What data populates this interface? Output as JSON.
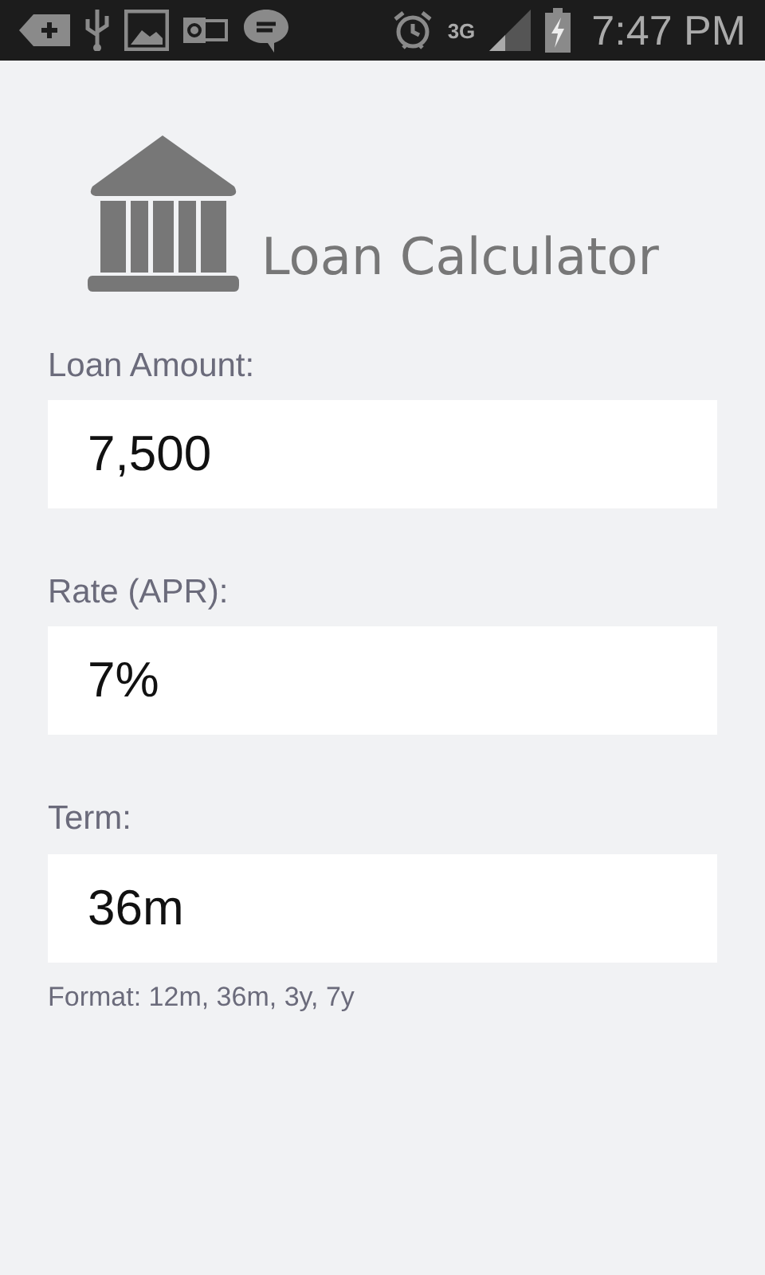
{
  "status_bar": {
    "network": "3G",
    "time": "7:47 PM"
  },
  "header": {
    "title": "Loan Calculator"
  },
  "fields": [
    {
      "label": "Loan Amount:",
      "value": "7,500"
    },
    {
      "label": "Rate (APR):",
      "value": "7%"
    },
    {
      "label": "Term:",
      "value": "36m",
      "hint": "Format: 12m, 36m, 3y, 7y"
    }
  ]
}
